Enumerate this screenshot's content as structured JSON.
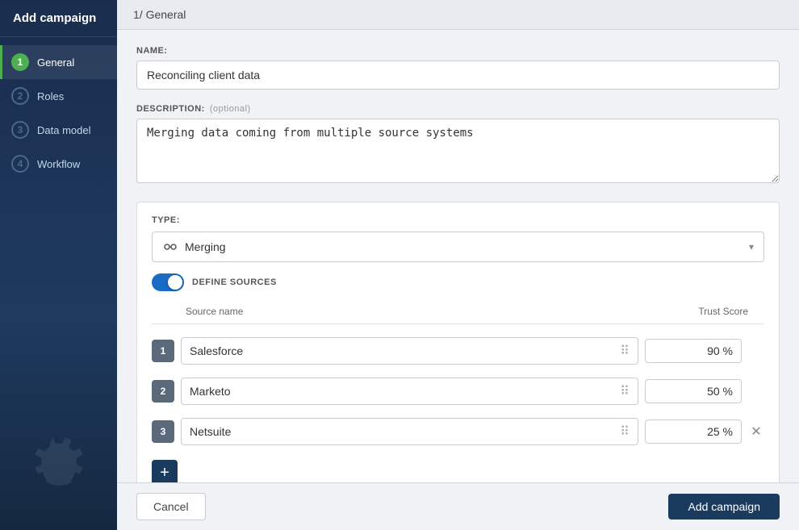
{
  "sidebar": {
    "title": "Add campaign",
    "steps": [
      {
        "id": 1,
        "label": "General",
        "active": true
      },
      {
        "id": 2,
        "label": "Roles",
        "active": false
      },
      {
        "id": 3,
        "label": "Data model",
        "active": false
      },
      {
        "id": 4,
        "label": "Workflow",
        "active": false
      }
    ]
  },
  "header": {
    "breadcrumb": "1/ General"
  },
  "form": {
    "name_label": "NAME:",
    "name_value": "Reconciling client data",
    "name_placeholder": "",
    "description_label": "DESCRIPTION:",
    "description_optional": "(optional)",
    "description_value": "Merging data coming from multiple source systems",
    "type_label": "TYPE:",
    "type_selected": "Merging",
    "toggle_label": "DEFINE SOURCES",
    "sources_header_name": "Source name",
    "sources_header_score": "Trust Score",
    "sources": [
      {
        "num": "1",
        "name": "Salesforce",
        "score": "90 %",
        "removable": false
      },
      {
        "num": "2",
        "name": "Marketo",
        "score": "50 %",
        "removable": false
      },
      {
        "num": "3",
        "name": "Netsuite",
        "score": "25 %",
        "removable": true
      }
    ],
    "add_button_label": "+"
  },
  "footer": {
    "cancel_label": "Cancel",
    "submit_label": "Add campaign"
  }
}
